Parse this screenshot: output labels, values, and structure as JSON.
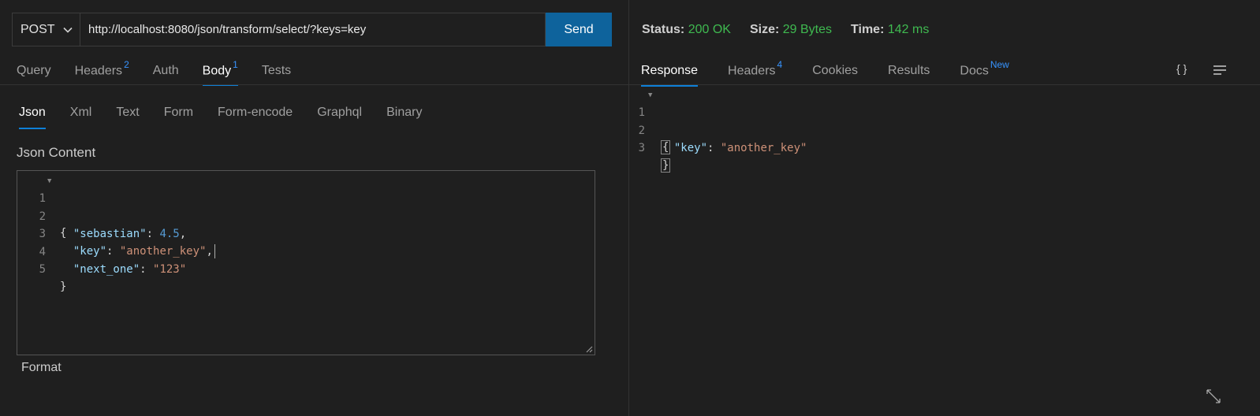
{
  "request": {
    "method": "POST",
    "url": "http://localhost:8080/json/transform/select/?keys=key",
    "send_label": "Send",
    "tabs": [
      {
        "label": "Query",
        "badge": ""
      },
      {
        "label": "Headers",
        "badge": "2"
      },
      {
        "label": "Auth",
        "badge": ""
      },
      {
        "label": "Body",
        "badge": "1"
      },
      {
        "label": "Tests",
        "badge": ""
      }
    ],
    "active_tab": "Body",
    "body_tabs": [
      "Json",
      "Xml",
      "Text",
      "Form",
      "Form-encode",
      "Graphql",
      "Binary"
    ],
    "active_body_tab": "Json",
    "content_label": "Json Content",
    "format_label": "Format",
    "editor": {
      "line_numbers": [
        "1",
        "2",
        "3",
        "4",
        "5"
      ],
      "open_brace": "{",
      "close_brace": "}",
      "entries": [
        {
          "key": "\"sebastian\"",
          "value": "4.5",
          "trail": ","
        },
        {
          "key": "\"key\"",
          "value": "\"another_key\"",
          "trail": ","
        },
        {
          "key": "\"next_one\"",
          "value": "\"123\"",
          "trail": ""
        }
      ]
    }
  },
  "response": {
    "status_label": "Status:",
    "status_value": "200 OK",
    "size_label": "Size:",
    "size_value": "29 Bytes",
    "time_label": "Time:",
    "time_value": "142 ms",
    "tabs": [
      {
        "label": "Response",
        "badge": ""
      },
      {
        "label": "Headers",
        "badge": "4"
      },
      {
        "label": "Cookies",
        "badge": ""
      },
      {
        "label": "Results",
        "badge": ""
      },
      {
        "label": "Docs",
        "badge": "New"
      }
    ],
    "active_tab": "Response",
    "braces_icon": "{ }",
    "menu_icon": "wrap-lines-icon",
    "editor": {
      "line_numbers": [
        "1",
        "2",
        "3"
      ],
      "open_brace": "{",
      "close_brace": "}",
      "key": "\"key\"",
      "value": "\"another_key\""
    }
  },
  "colors": {
    "accent": "#0e639c",
    "success": "#3fb950",
    "badge": "#3794ff"
  }
}
